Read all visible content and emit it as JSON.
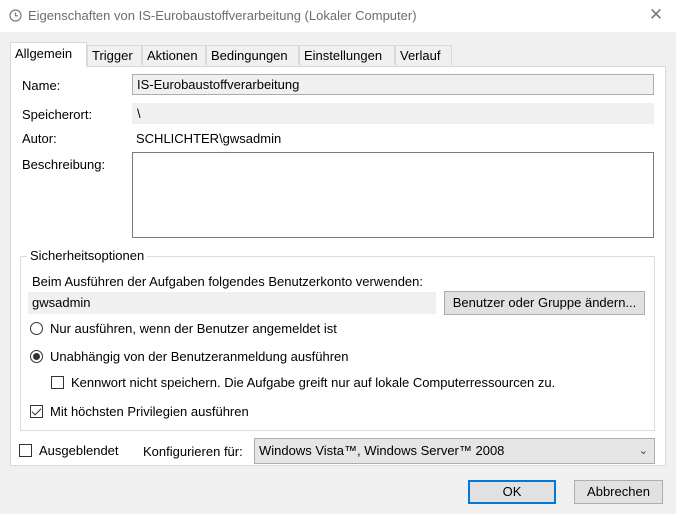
{
  "window": {
    "title": "Eigenschaften von IS-Eurobaustoffverarbeitung (Lokaler Computer)",
    "close_label": "✕"
  },
  "tabs": [
    {
      "label": "Allgemein",
      "active": true
    },
    {
      "label": "Trigger"
    },
    {
      "label": "Aktionen"
    },
    {
      "label": "Bedingungen"
    },
    {
      "label": "Einstellungen"
    },
    {
      "label": "Verlauf"
    }
  ],
  "general": {
    "name_label": "Name:",
    "name_value": "IS-Eurobaustoffverarbeitung",
    "location_label": "Speicherort:",
    "location_value": "\\",
    "author_label": "Autor:",
    "author_value": "SCHLICHTER\\gwsadmin",
    "description_label": "Beschreibung:",
    "description_value": ""
  },
  "security": {
    "legend": "Sicherheitsoptionen",
    "account_prompt": "Beim Ausführen der Aufgaben folgendes Benutzerkonto verwenden:",
    "account_value": "gwsadmin",
    "change_user_button": "Benutzer oder Gruppe ändern...",
    "radio_logged_on": "Nur ausführen, wenn der Benutzer angemeldet ist",
    "radio_independent": "Unabhängig von der Benutzeranmeldung ausführen",
    "no_password_label": "Kennwort nicht speichern. Die Aufgabe greift nur auf lokale Computerressourcen zu.",
    "highest_privileges_label": "Mit höchsten Privilegien ausführen"
  },
  "footer": {
    "hidden_label": "Ausgeblendet",
    "configure_label": "Konfigurieren für:",
    "configure_value": "Windows Vista™, Windows Server™ 2008",
    "ok_button": "OK",
    "cancel_button": "Abbrechen"
  },
  "colors": {
    "accent": "#0078d7",
    "panel": "#f0f0f0"
  }
}
